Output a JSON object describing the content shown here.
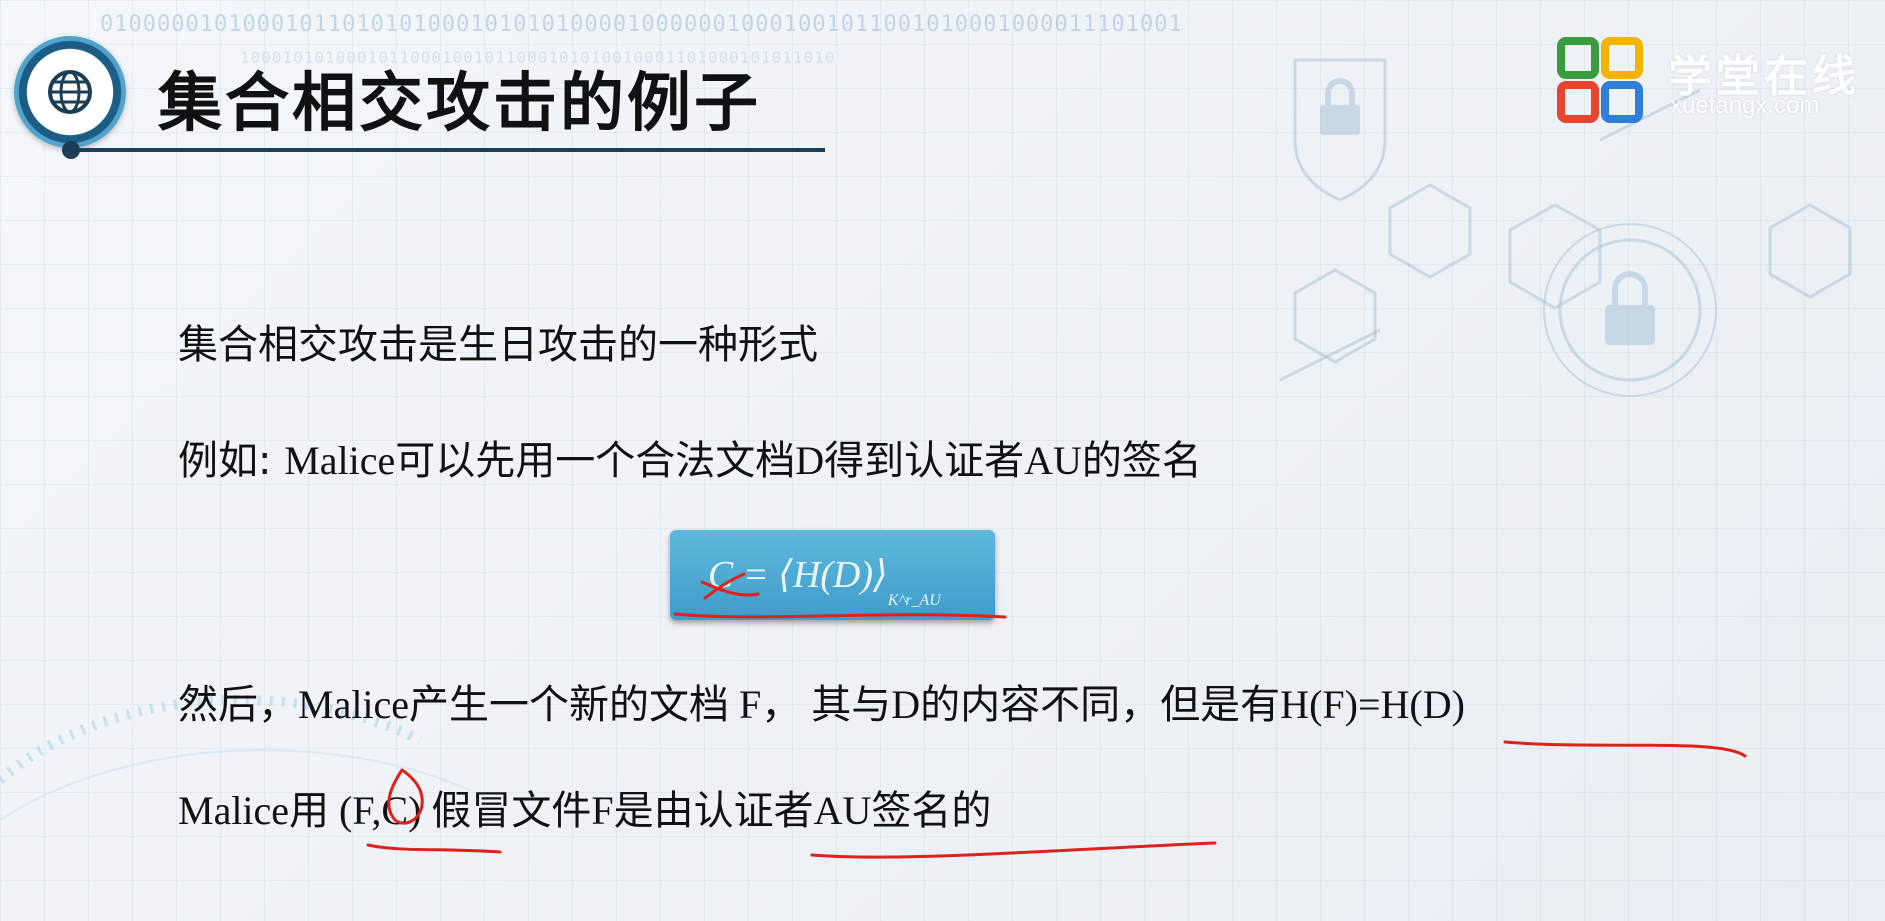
{
  "slide": {
    "title": "集合相交攻击的例子",
    "binary_text_1": "0100000101000101101010100010101010000100000010001001011001010001000011101001",
    "binary_text_2": "10001010100010110001001011000101010010001101000101011010"
  },
  "logo": {
    "name": "学堂在线",
    "url": "xuetangx.com",
    "colors": [
      "#3a9c3f",
      "#f2b400",
      "#e8452e",
      "#2f7fd8"
    ]
  },
  "content": {
    "line1": "集合相交攻击是生日攻击的一种形式",
    "line2_prefix": "例如: ",
    "line2_rest": "Malice可以先用一个合法文档D得到认证者AU的签名",
    "formula_main": "C = ⟨H(D)⟩",
    "formula_sub": "K^r_AU",
    "line3_prefix": "然后，",
    "line3_rest": "Malice产生一个新的文档 F， 其与D的内容不同，但是有H(F)=H(D)",
    "line4": "Malice用 (F,C) 假冒文件F是由认证者AU签名的"
  },
  "annotation_color": "#e0201c"
}
